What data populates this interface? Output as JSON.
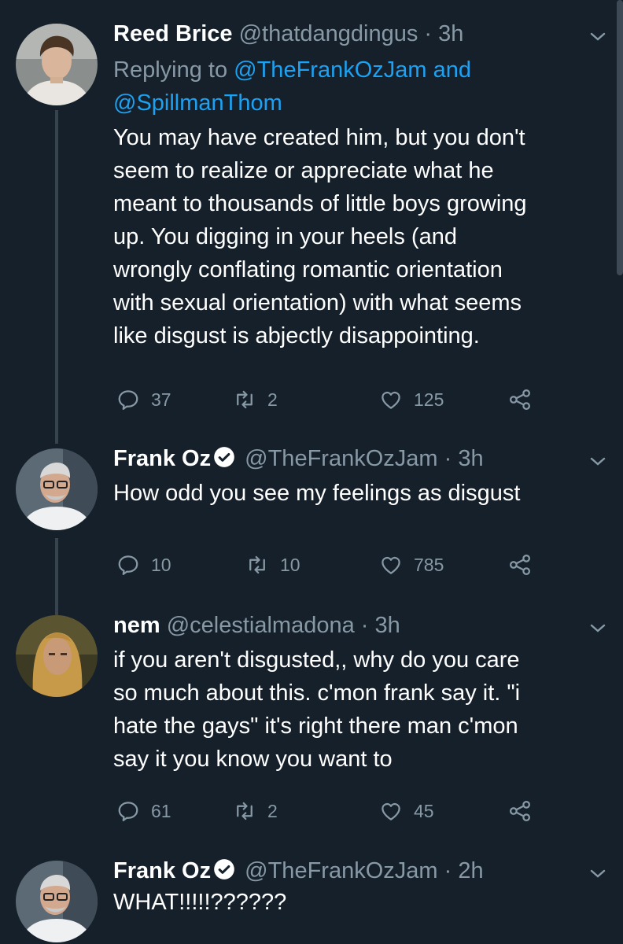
{
  "tweets": [
    {
      "name": "Reed Brice",
      "handle": "@thatdangdingus",
      "dot": "·",
      "time": "3h",
      "reply_prefix": "Replying to",
      "reply_mention1": "@TheFrankOzJam",
      "reply_and": "and",
      "reply_mention2": "@SpillmanThom",
      "text": "You may have created him, but you don't\nseem to realize or appreciate what he\nmeant to thousands of little boys growing\nup. You digging in your heels (and\nwrongly conflating romantic orientation\nwith sexual orientation) with what seems\nlike disgust is abjectly disappointing.",
      "replies": "37",
      "retweets": "2",
      "likes": "125"
    },
    {
      "name": "Frank Oz",
      "handle": "@TheFrankOzJam",
      "dot": "·",
      "time": "3h",
      "text": "How odd you see my feelings as disgust",
      "replies": "10",
      "retweets": "10",
      "likes": "785"
    },
    {
      "name": "nem",
      "handle": "@celestialmadona",
      "dot": "·",
      "time": "3h",
      "text": "if you aren't disgusted,, why do you care\nso much about this. c'mon frank say it. \"i\nhate the gays\" it's right there man c'mon\nsay it you know you want to",
      "replies": "61",
      "retweets": "2",
      "likes": "45"
    },
    {
      "name": "Frank Oz",
      "handle": "@TheFrankOzJam",
      "dot": "·",
      "time": "2h",
      "text": "WHAT!!!!!??????"
    }
  ],
  "colors": {
    "background": "#15202b",
    "secondary_text": "#8899a6",
    "link": "#1da1f2",
    "thread_line": "#38444d"
  },
  "icons": [
    "reply-icon",
    "retweet-icon",
    "like-icon",
    "share-icon",
    "chevron-down-icon",
    "verified-badge-icon"
  ]
}
